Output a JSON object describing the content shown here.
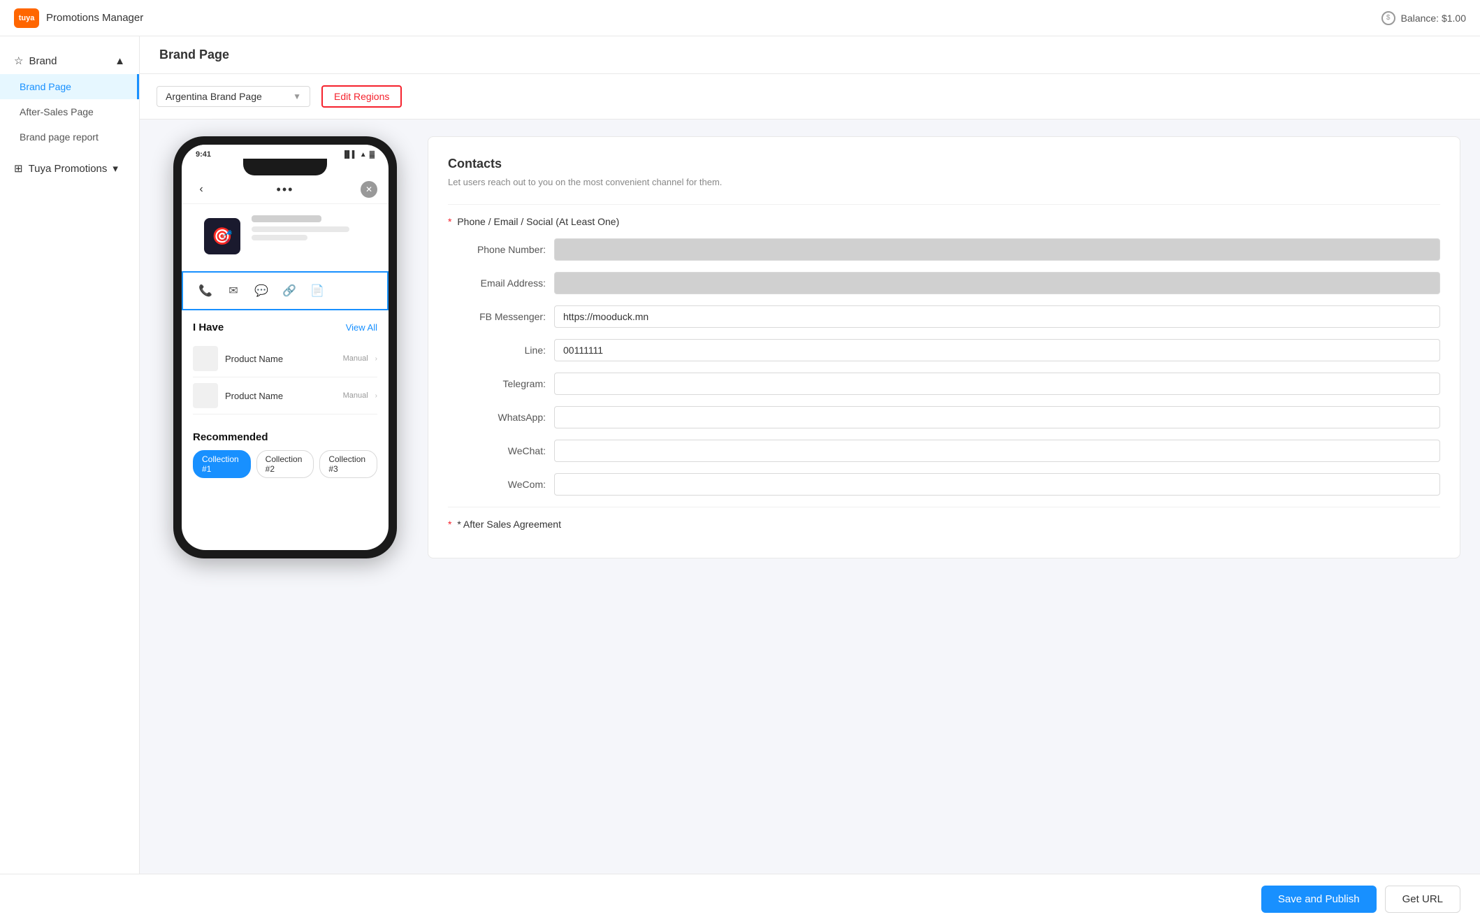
{
  "header": {
    "logo_text": "tuya",
    "app_title": "Promotions Manager",
    "balance_label": "Balance: $1.00"
  },
  "sidebar": {
    "brand_section": {
      "label": "Brand",
      "chevron": "▲",
      "items": [
        {
          "label": "Brand Page",
          "active": true
        },
        {
          "label": "After-Sales Page",
          "active": false
        },
        {
          "label": "Brand page report",
          "active": false
        }
      ]
    },
    "promotions_section": {
      "label": "Tuya Promotions",
      "chevron": "▾"
    }
  },
  "page_header": {
    "title": "Brand Page"
  },
  "region_bar": {
    "selected_region": "Argentina Brand Page",
    "edit_button": "Edit Regions"
  },
  "phone": {
    "time": "9:41",
    "signal": "▐▌▌",
    "wifi": "▲",
    "battery": "▓",
    "back_icon": "‹",
    "dots": "•••",
    "close": "✕",
    "i_have_title": "I Have",
    "view_all": "View All",
    "product1": "Product Name",
    "product1_tag": "Manual",
    "product2": "Product Name",
    "product2_tag": "Manual",
    "recommended_title": "Recommended",
    "collections": [
      {
        "label": "Collection #1",
        "active": true
      },
      {
        "label": "Collection #2",
        "active": false
      },
      {
        "label": "Collection #3",
        "active": false
      }
    ]
  },
  "contacts_panel": {
    "title": "Contacts",
    "subtitle": "Let users reach out to you on the most convenient channel for them.",
    "required_label": "Phone / Email / Social (At Least One)",
    "fields": [
      {
        "label": "Phone Number:",
        "value": "",
        "blurred": true,
        "placeholder": ""
      },
      {
        "label": "Email Address:",
        "value": "",
        "blurred": true,
        "placeholder": ""
      },
      {
        "label": "FB Messenger:",
        "value": "https://mooduck.mn",
        "blurred": false,
        "placeholder": ""
      },
      {
        "label": "Line:",
        "value": "00111111",
        "blurred": false,
        "placeholder": ""
      },
      {
        "label": "Telegram:",
        "value": "",
        "blurred": false,
        "placeholder": ""
      },
      {
        "label": "WhatsApp:",
        "value": "",
        "blurred": false,
        "placeholder": ""
      },
      {
        "label": "WeChat:",
        "value": "",
        "blurred": false,
        "placeholder": ""
      },
      {
        "label": "WeCom:",
        "value": "",
        "blurred": false,
        "placeholder": ""
      }
    ],
    "after_sales_label": "* After Sales Agreement"
  },
  "bottom_bar": {
    "save_publish": "Save and Publish",
    "get_url": "Get URL"
  }
}
